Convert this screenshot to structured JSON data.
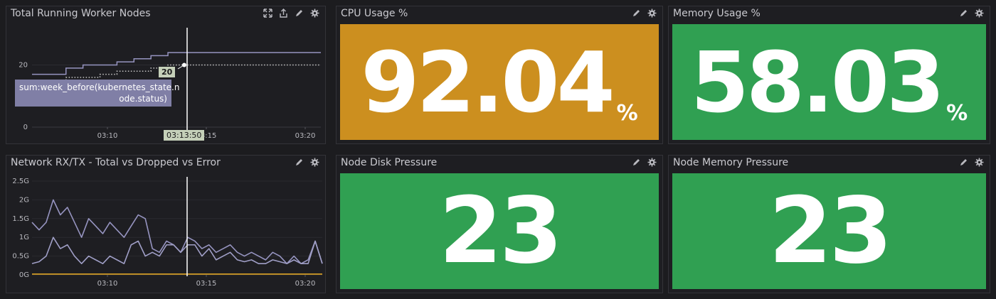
{
  "panels": {
    "worker_nodes": {
      "title": "Total Running Worker Nodes"
    },
    "network": {
      "title": "Network RX/TX - Total vs Dropped vs Error"
    },
    "cpu": {
      "title": "CPU Usage %",
      "value": "92.04",
      "unit": "%",
      "color": "#cc8f1f"
    },
    "memory": {
      "title": "Memory Usage %",
      "value": "58.03",
      "unit": "%",
      "color": "#30a052"
    },
    "disk_pressure": {
      "title": "Node Disk Pressure",
      "value": "23",
      "color": "#30a052"
    },
    "mem_pressure": {
      "title": "Node Memory Pressure",
      "value": "23",
      "color": "#30a052"
    }
  },
  "tooltip": {
    "value": "20",
    "series": "sum:week_before(kubernetes_state.n ode.status)",
    "time": "03:13:50"
  },
  "chart_data": [
    {
      "type": "line",
      "x": [
        "03:05",
        "03:06",
        "03:07",
        "03:08",
        "03:09",
        "03:10",
        "03:11",
        "03:12",
        "03:13",
        "03:14",
        "03:15",
        "03:16",
        "03:17",
        "03:18",
        "03:19",
        "03:20",
        "03:21",
        "03:22"
      ],
      "x_ticks": [
        "03:10",
        "03:15",
        "03:20"
      ],
      "y_ticks": [
        "0",
        "20"
      ],
      "ylim": [
        0,
        32
      ],
      "series": [
        {
          "values": [
            17,
            17,
            19,
            20,
            20,
            21,
            22,
            23,
            24,
            24,
            24,
            24,
            24,
            24,
            24,
            24,
            24,
            24
          ],
          "color": "#9694c0",
          "style": "solid"
        },
        {
          "values": [
            15,
            15,
            16,
            16,
            17,
            18,
            18,
            19,
            20,
            20,
            20,
            20,
            20,
            20,
            20,
            20,
            20,
            20
          ],
          "color": "#c8c8c8",
          "style": "dotted"
        }
      ]
    },
    {
      "type": "line",
      "x_ticks": [
        "03:10",
        "03:15",
        "03:20"
      ],
      "y_ticks": [
        "0G",
        "0.5G",
        "1G",
        "1.5G",
        "2G",
        "2.5G"
      ],
      "ylim": [
        0,
        2.5
      ],
      "series": [
        {
          "values": [
            1.4,
            1.2,
            1.4,
            2.0,
            1.6,
            1.8,
            1.4,
            1.0,
            1.5,
            1.3,
            1.1,
            1.4,
            1.2,
            1.0,
            1.3,
            1.6,
            1.5,
            0.7,
            0.6,
            0.9,
            0.8,
            0.6,
            1.0,
            0.9,
            0.7,
            0.8,
            0.6,
            0.7,
            0.8,
            0.6,
            0.5,
            0.6,
            0.5,
            0.4,
            0.6,
            0.5,
            0.3,
            0.5,
            0.3,
            0.4,
            0.9,
            0.3
          ],
          "color": "#9694c0"
        },
        {
          "values": [
            0.3,
            0.35,
            0.5,
            1.0,
            0.7,
            0.8,
            0.5,
            0.3,
            0.5,
            0.4,
            0.3,
            0.5,
            0.4,
            0.3,
            0.8,
            0.9,
            0.5,
            0.6,
            0.5,
            0.8,
            0.8,
            0.6,
            0.8,
            0.8,
            0.5,
            0.7,
            0.4,
            0.5,
            0.6,
            0.4,
            0.35,
            0.4,
            0.3,
            0.3,
            0.4,
            0.35,
            0.3,
            0.4,
            0.3,
            0.3,
            0.9,
            0.3
          ],
          "color": "#a09fc7"
        },
        {
          "values": [
            0.02,
            0.02,
            0.02,
            0.02,
            0.02,
            0.02,
            0.02,
            0.02,
            0.02,
            0.02,
            0.02,
            0.02,
            0.02,
            0.02,
            0.02,
            0.02,
            0.02,
            0.02,
            0.02,
            0.02,
            0.02,
            0.02,
            0.02,
            0.02,
            0.02,
            0.02,
            0.02,
            0.02,
            0.02,
            0.02,
            0.02,
            0.02,
            0.02,
            0.02,
            0.02,
            0.02,
            0.02,
            0.02,
            0.02,
            0.02,
            0.02,
            0.02
          ],
          "color": "#e0a526"
        }
      ]
    }
  ]
}
